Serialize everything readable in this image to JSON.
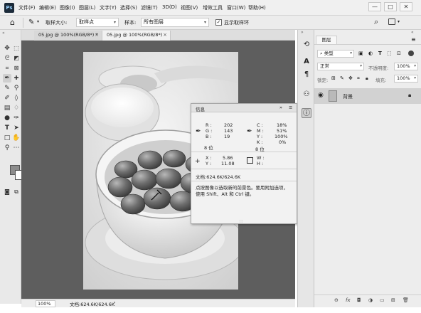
{
  "app": {
    "logo": "Ps"
  },
  "menu": {
    "items": [
      "文件(F)",
      "编辑(E)",
      "图像(I)",
      "图层(L)",
      "文字(Y)",
      "选择(S)",
      "滤镜(T)",
      "3D(D)",
      "视图(V)",
      "增效工具",
      "窗口(W)",
      "帮助(H)"
    ],
    "window_buttons": [
      "—",
      "□",
      "✕"
    ]
  },
  "options_bar": {
    "home_icon": "home-icon",
    "sample_size_label": "取样大小:",
    "sample_size_value": "取样点",
    "sample_label": "样本:",
    "sample_value": "所有图层",
    "show_ring_label": "显示取样环",
    "show_ring_checked": true,
    "icons": [
      "search-icon",
      "workspace-icon"
    ]
  },
  "tabs": [
    {
      "label": "05.jpg @ 100%(RGB/8*) *",
      "active": false
    },
    {
      "label": "05.jpg @ 100%(RGB/8*)",
      "active": true
    }
  ],
  "info_panel": {
    "title": "信息",
    "rgb": {
      "r_label": "R :",
      "r": "202",
      "g_label": "G :",
      "g": "143",
      "b_label": "B :",
      "b": "19",
      "bits": "8 位"
    },
    "cmyk": {
      "c_label": "C :",
      "c": "18%",
      "m_label": "M :",
      "m": "51%",
      "y_label": "Y :",
      "y": "100%",
      "k_label": "K :",
      "k": "0%",
      "bits": "8 位"
    },
    "coords": {
      "x_label": "X :",
      "x": "5.86",
      "y_label": "Y :",
      "y": "11.08"
    },
    "size": {
      "w_label": "W :",
      "w": "",
      "h_label": "H :",
      "h": ""
    },
    "doc": "文档:624.6K/624.6K",
    "hint": "点按图像以选取新的前景色。要用附加选项，使用 Shift、Alt 和 Ctrl 键。"
  },
  "status_bar": {
    "zoom": "100%",
    "doc": "文档:624.6K/624.6K"
  },
  "layers_panel": {
    "tab": "图层",
    "filter_kind": "类型",
    "blend_mode": "正常",
    "opacity_label": "不透明度:",
    "opacity": "100%",
    "lock_label": "锁定:",
    "fill_label": "填充:",
    "fill": "100%",
    "layer_name": "背景",
    "bottom_icons": [
      "link-icon",
      "fx-icon",
      "mask-icon",
      "adjustment-icon",
      "group-icon",
      "new-layer-icon",
      "trash-icon"
    ]
  },
  "colors": {
    "foreground": "#8c8c8c",
    "background": "#ffffff",
    "canvas_bg": "#5e5e5e"
  }
}
